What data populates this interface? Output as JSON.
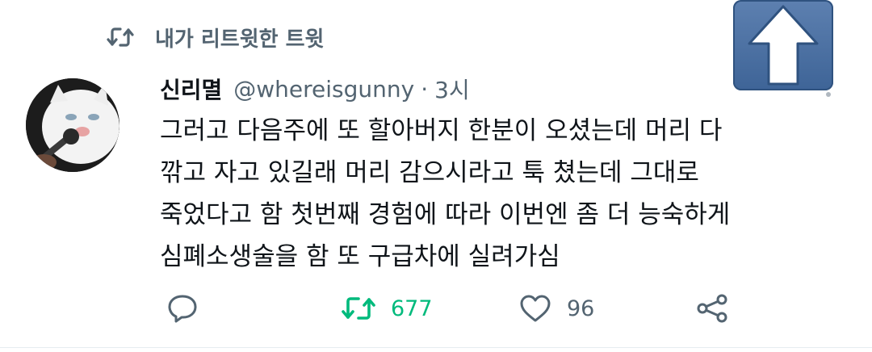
{
  "retweet_header": {
    "label": "내가 리트윗한 트윗",
    "icon": "retweet-icon"
  },
  "tweet": {
    "display_name": "신리멸",
    "handle": "@whereisgunny",
    "separator": "·",
    "time": "3시",
    "text_lines": [
      "그러고 다음주에 또 할아버지 한분이 오셨는데 머리 다",
      "깎고 자고 있길래 머리 감으시라고 툭 쳤는데 그대로",
      "죽었다고 함 첫번째 경험에 따라 이번엔 좀 더 능숙하게",
      "심폐소생술을 함 또 구급차에 실려가심"
    ]
  },
  "actions": {
    "reply": {
      "icon": "reply-icon",
      "count": ""
    },
    "retweet": {
      "icon": "retweet-icon",
      "count": "677",
      "color": "#00ba7c"
    },
    "like": {
      "icon": "heart-icon",
      "count": "96"
    },
    "share": {
      "icon": "share-icon",
      "count": ""
    }
  },
  "overlay": {
    "icon": "upvote-arrow-icon",
    "color": "#4a6fa5"
  },
  "colors": {
    "secondary": "#536471",
    "text": "#0f1419",
    "retweet_green": "#00ba7c"
  }
}
